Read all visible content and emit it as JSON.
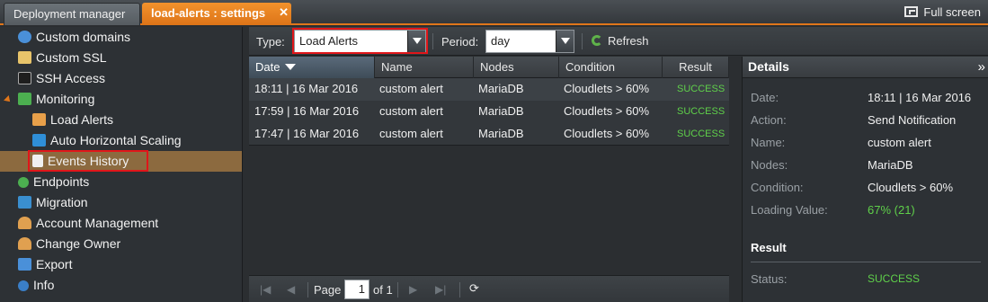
{
  "tabs": {
    "deployment_manager": "Deployment manager",
    "settings": "load-alerts : settings",
    "close_glyph": "✕",
    "fullscreen": "Full screen"
  },
  "sidebar": {
    "items": [
      {
        "label": "Custom domains",
        "icon": "globe-icon",
        "color": "#4a90d9"
      },
      {
        "label": "Custom SSL",
        "icon": "certificate-icon",
        "color": "#e8c46a"
      },
      {
        "label": "SSH Access",
        "icon": "terminal-icon",
        "color": "#3c3c3c"
      },
      {
        "label": "Monitoring",
        "icon": "monitoring-icon",
        "color": "#4caf50"
      },
      {
        "label": "Load Alerts",
        "icon": "mail-alert-icon",
        "color": "#e8a04a"
      },
      {
        "label": "Auto Horizontal Scaling",
        "icon": "scaling-icon",
        "color": "#2f8fd8"
      },
      {
        "label": "Events History",
        "icon": "document-icon",
        "color": "#f0f0f0"
      },
      {
        "label": "Endpoints",
        "icon": "endpoints-icon",
        "color": "#4caf50"
      },
      {
        "label": "Migration",
        "icon": "migration-icon",
        "color": "#3a8fd0"
      },
      {
        "label": "Account Management",
        "icon": "users-icon",
        "color": "#e0a050"
      },
      {
        "label": "Change Owner",
        "icon": "change-owner-icon",
        "color": "#e0a050"
      },
      {
        "label": "Export",
        "icon": "export-icon",
        "color": "#4a90d9"
      },
      {
        "label": "Info",
        "icon": "info-icon",
        "color": "#3a7fc8"
      }
    ]
  },
  "toolbar": {
    "type_label": "Type:",
    "type_value": "Load Alerts",
    "period_label": "Period:",
    "period_value": "day",
    "refresh_label": "Refresh"
  },
  "grid": {
    "columns": [
      "Date",
      "Name",
      "Nodes",
      "Condition",
      "Result"
    ],
    "rows": [
      {
        "date": "18:11 | 16 Mar 2016",
        "name": "custom alert",
        "nodes": "MariaDB",
        "condition": "Cloudlets > 60%",
        "result": "SUCCESS"
      },
      {
        "date": "17:59 | 16 Mar 2016",
        "name": "custom alert",
        "nodes": "MariaDB",
        "condition": "Cloudlets > 60%",
        "result": "SUCCESS"
      },
      {
        "date": "17:47 | 16 Mar 2016",
        "name": "custom alert",
        "nodes": "MariaDB",
        "condition": "Cloudlets > 60%",
        "result": "SUCCESS"
      }
    ]
  },
  "pager": {
    "page_label": "Page",
    "page_value": "1",
    "of_label": "of 1"
  },
  "details": {
    "title": "Details",
    "fields": [
      {
        "label": "Date:",
        "value": "18:11 | 16 Mar 2016"
      },
      {
        "label": "Action:",
        "value": "Send Notification"
      },
      {
        "label": "Name:",
        "value": "custom alert"
      },
      {
        "label": "Nodes:",
        "value": "MariaDB"
      },
      {
        "label": "Condition:",
        "value": "Cloudlets > 60%"
      },
      {
        "label": "Loading Value:",
        "value": "67% (21)"
      }
    ],
    "result_title": "Result",
    "status_label": "Status:",
    "status_value": "SUCCESS"
  },
  "colors": {
    "accent": "#e0761a",
    "success": "#5fd04a",
    "selected_row": "#8c6a3f",
    "highlight_box": "#e0161a"
  }
}
